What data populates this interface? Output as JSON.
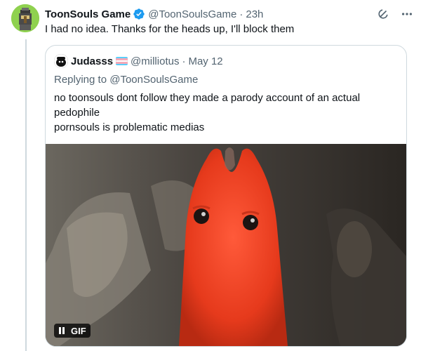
{
  "tweet": {
    "author_name": "ToonSouls Game",
    "handle": "@ToonSoulsGame",
    "separator": "·",
    "time": "23h",
    "text": "I had no idea. Thanks for the heads up, I'll block them"
  },
  "quote": {
    "author_name": "Judasss",
    "handle": "@milliotus",
    "separator": "·",
    "date": "May 12",
    "replying_to": "Replying to @ToonSoulsGame",
    "body_lines": [
      "no toonsouls dont follow they made a parody account of an actual",
      "pedophile",
      "pornsouls is problematic medias"
    ],
    "media": {
      "badge": "GIF"
    }
  },
  "icons": {
    "verified": "verified-badge-icon",
    "grok": "grok-icon",
    "more": "more-icon",
    "pause": "pause-icon"
  },
  "colors": {
    "verified_blue": "#1d9bf0",
    "text_secondary": "#536471",
    "border": "#cfd9de",
    "flag": [
      "#5bcefa",
      "#f5a9b8",
      "#ffffff",
      "#f5a9b8",
      "#5bcefa"
    ]
  }
}
